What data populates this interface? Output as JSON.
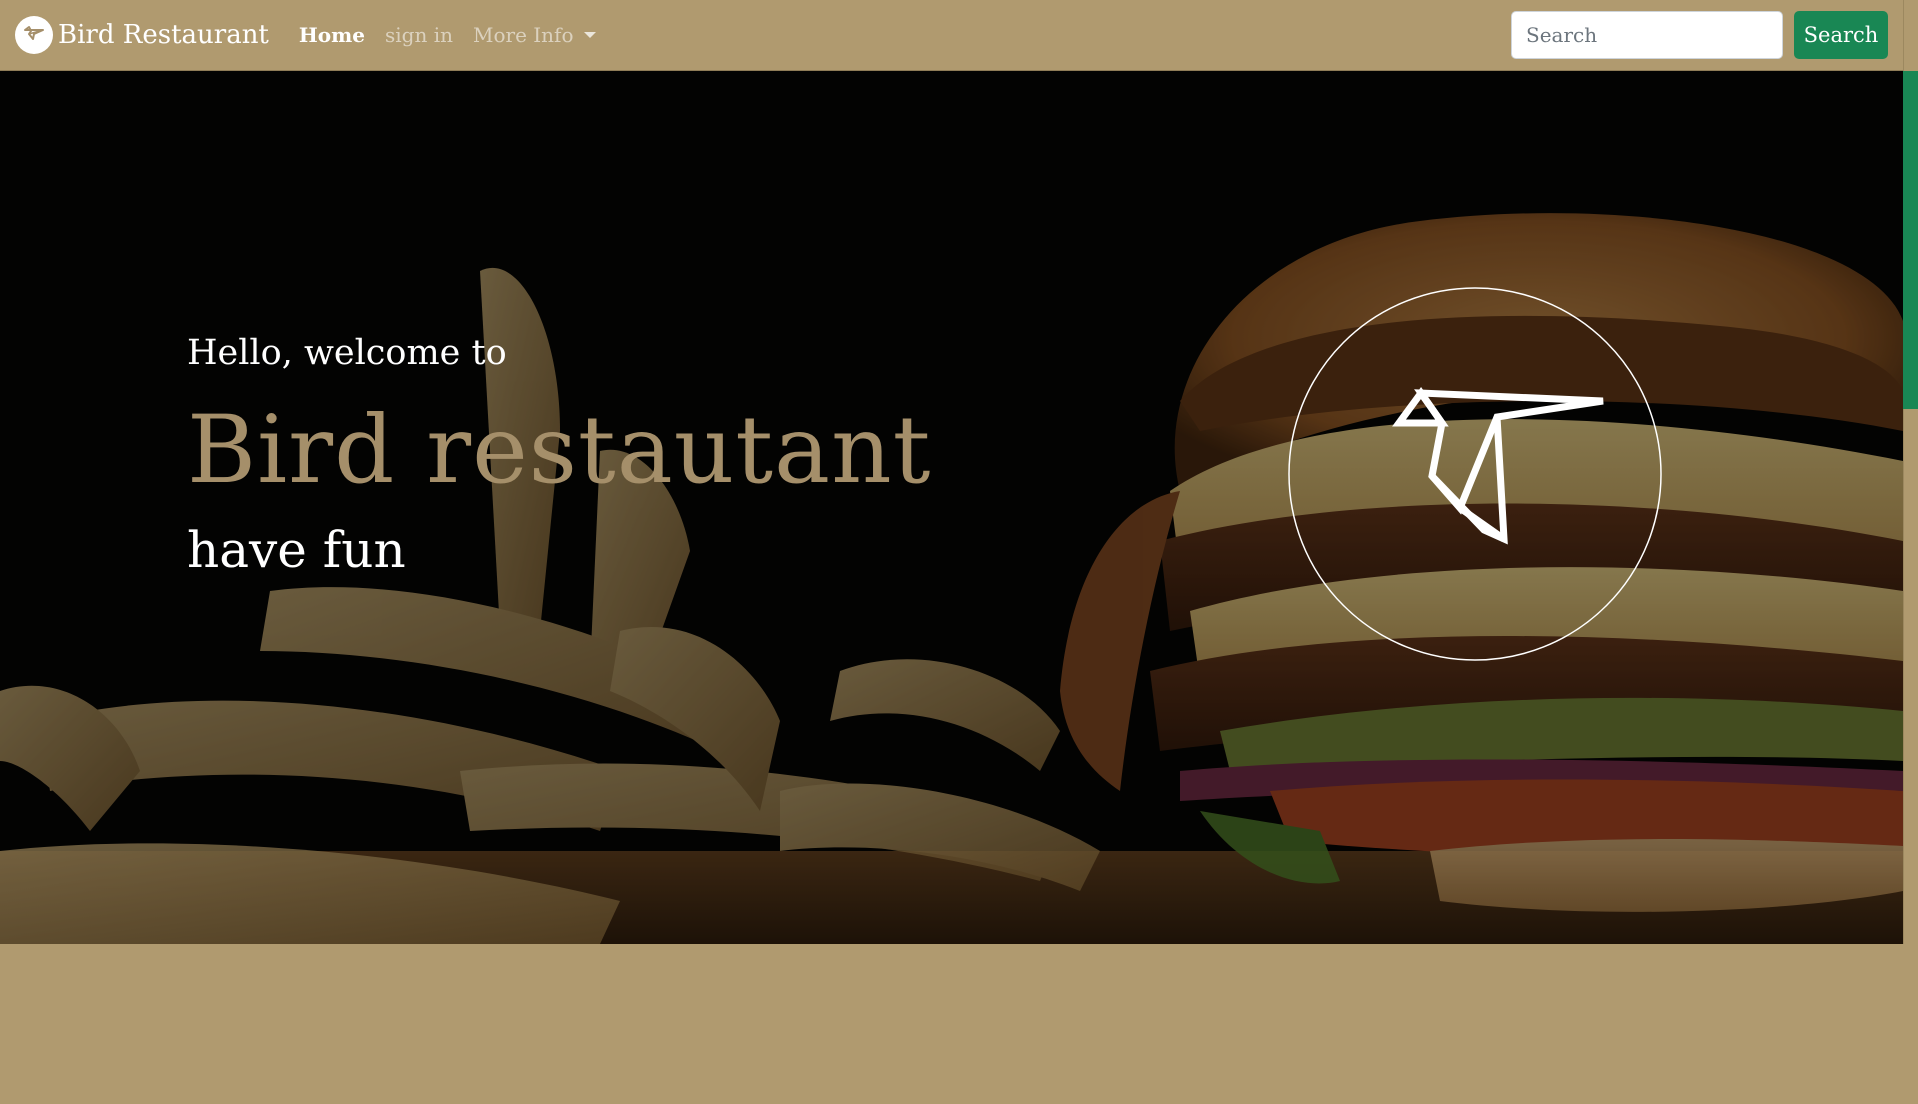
{
  "navbar": {
    "brand_name": "Bird Restaurant",
    "links": [
      {
        "label": "Home",
        "active": true
      },
      {
        "label": "sign in",
        "active": false
      },
      {
        "label": "More Info",
        "active": false,
        "dropdown": true
      }
    ],
    "search_placeholder": "Search",
    "search_button_label": "Search",
    "colors": {
      "navbar_bg": "#b09a6f",
      "search_button": "#198754"
    }
  },
  "hero": {
    "greeting": "Hello, welcome to",
    "title": "Bird restautant",
    "tagline": "have fun",
    "emblem_icon": "origami-bird-icon",
    "background_image": "burger-and-fries-photo",
    "colors": {
      "title": "#a58f6a",
      "text": "#ffffff"
    }
  }
}
